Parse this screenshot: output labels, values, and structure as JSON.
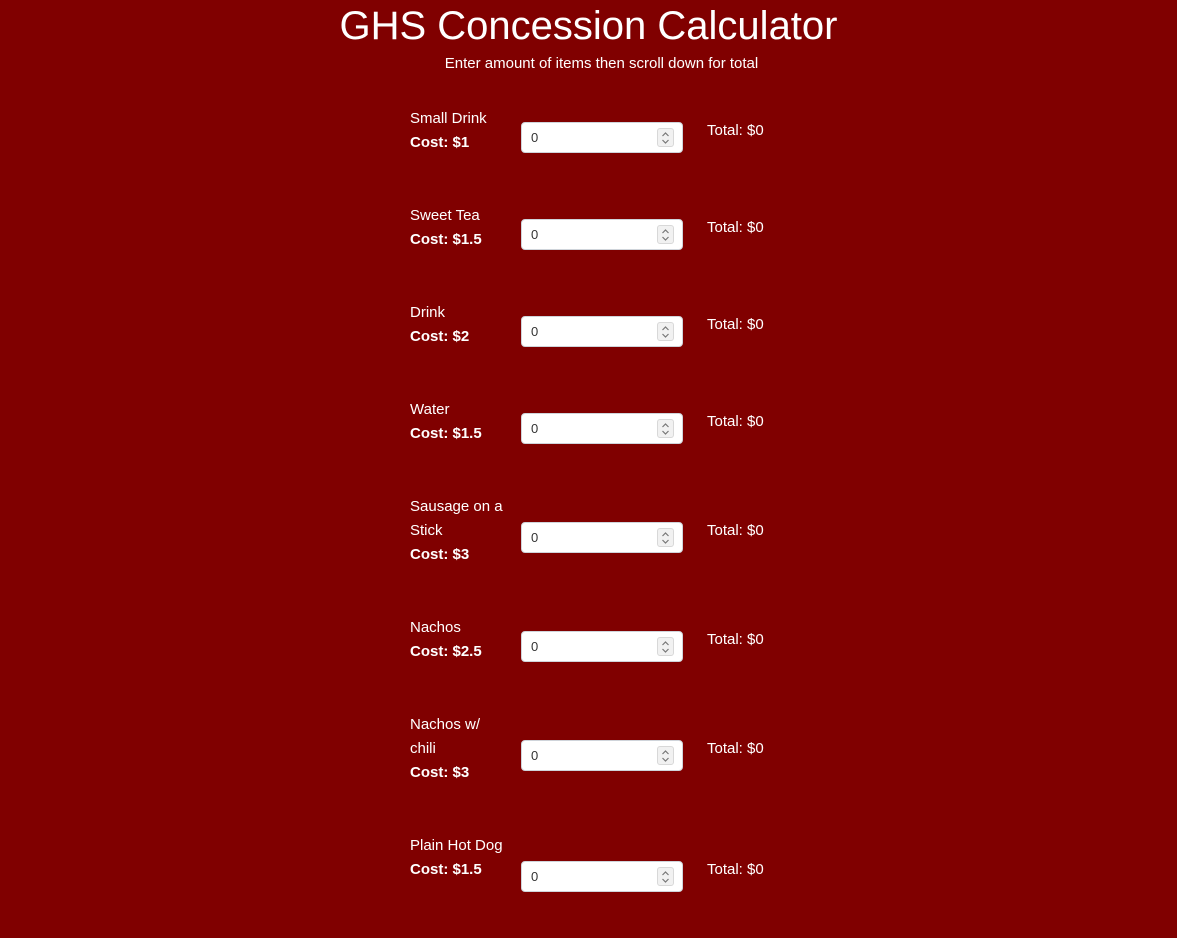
{
  "header": {
    "title": "GHS Concession Calculator",
    "subtitle": "Enter amount of items then scroll down for total"
  },
  "items": [
    {
      "name": "Small Drink",
      "cost": "Cost: $1",
      "quantity": "0",
      "total": "Total: $0"
    },
    {
      "name": "Sweet Tea",
      "cost": "Cost: $1.5",
      "quantity": "0",
      "total": "Total: $0"
    },
    {
      "name": "Drink",
      "cost": "Cost: $2",
      "quantity": "0",
      "total": "Total: $0"
    },
    {
      "name": "Water",
      "cost": "Cost: $1.5",
      "quantity": "0",
      "total": "Total: $0"
    },
    {
      "name": "Sausage on a Stick",
      "cost": "Cost: $3",
      "quantity": "0",
      "total": "Total: $0"
    },
    {
      "name": "Nachos",
      "cost": "Cost: $2.5",
      "quantity": "0",
      "total": "Total: $0"
    },
    {
      "name": "Nachos w/ chili",
      "cost": "Cost: $3",
      "quantity": "0",
      "total": "Total: $0"
    },
    {
      "name": "Plain Hot Dog",
      "cost": "Cost: $1.5",
      "quantity": "0",
      "total": "Total: $0"
    }
  ],
  "colors": {
    "background": "#800000",
    "text": "#ffffff",
    "input_background": "#ffffff"
  }
}
